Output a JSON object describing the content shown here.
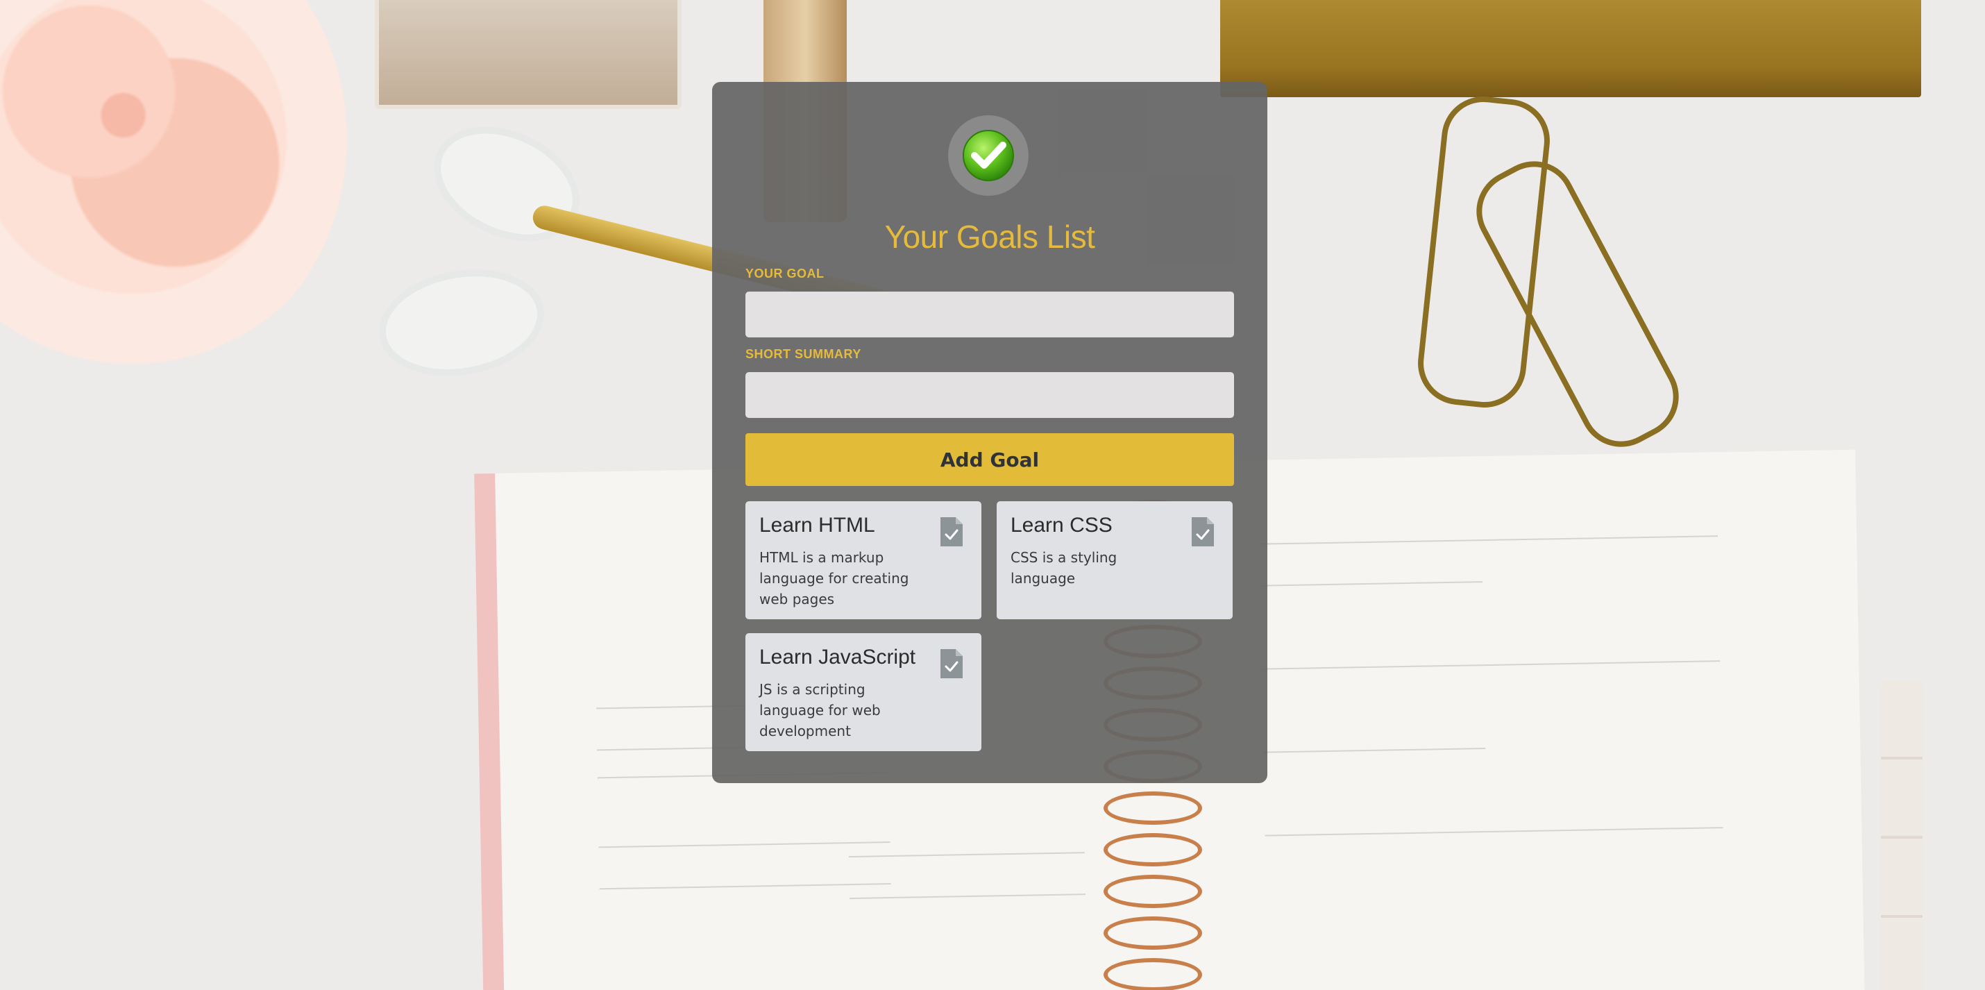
{
  "app": {
    "title": "Your Goals List",
    "accent_color": "#e6bb3c",
    "panel_color": "#656565"
  },
  "form": {
    "goal_label": "YOUR GOAL",
    "goal_value": "",
    "summary_label": "SHORT SUMMARY",
    "summary_value": "",
    "add_button_label": "Add Goal"
  },
  "goals": [
    {
      "title": "Learn HTML",
      "summary": "HTML is a markup language for creating web pages",
      "icon": "document-check-icon"
    },
    {
      "title": "Learn CSS",
      "summary": "CSS is a styling language",
      "icon": "document-check-icon"
    },
    {
      "title": "Learn JavaScript",
      "summary": "JS is a scripting language for web development",
      "icon": "document-check-icon"
    }
  ],
  "icons": {
    "header": "green-checkmark-icon"
  }
}
